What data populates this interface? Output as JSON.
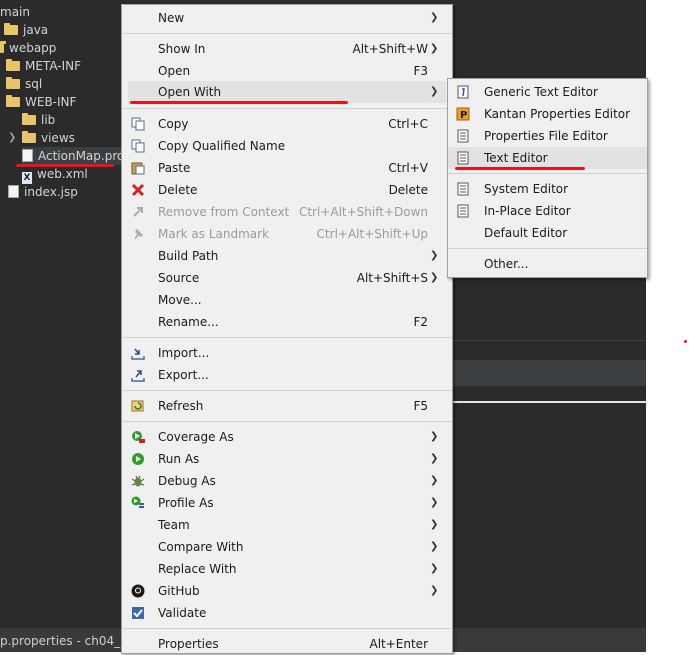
{
  "tree": {
    "items": [
      {
        "label": "main"
      },
      {
        "label": "java"
      },
      {
        "label": "webapp"
      },
      {
        "label": "META-INF"
      },
      {
        "label": "sql"
      },
      {
        "label": "WEB-INF"
      },
      {
        "label": "lib"
      },
      {
        "label": "views"
      },
      {
        "label": "ActionMap.pro"
      },
      {
        "label": "web.xml"
      },
      {
        "label": "index.jsp"
      }
    ]
  },
  "statusbar": {
    "text": "p.properties -   ch04_m"
  },
  "context_menu": {
    "new": "New",
    "show_in": "Show In",
    "show_in_accel": "Alt+Shift+W",
    "open": "Open",
    "open_accel": "F3",
    "open_with": "Open With",
    "copy": "Copy",
    "copy_accel": "Ctrl+C",
    "copy_qualified": "Copy Qualified Name",
    "paste": "Paste",
    "paste_accel": "Ctrl+V",
    "delete": "Delete",
    "delete_accel": "Delete",
    "remove_context": "Remove from Context",
    "remove_context_accel": "Ctrl+Alt+Shift+Down",
    "mark_landmark": "Mark as Landmark",
    "mark_landmark_accel": "Ctrl+Alt+Shift+Up",
    "build_path": "Build Path",
    "source": "Source",
    "source_accel": "Alt+Shift+S",
    "move": "Move...",
    "rename": "Rename...",
    "rename_accel": "F2",
    "import": "Import...",
    "export": "Export...",
    "refresh": "Refresh",
    "refresh_accel": "F5",
    "coverage_as": "Coverage As",
    "run_as": "Run As",
    "debug_as": "Debug As",
    "profile_as": "Profile As",
    "team": "Team",
    "compare_with": "Compare With",
    "replace_with": "Replace With",
    "github": "GitHub",
    "validate": "Validate",
    "properties": "Properties",
    "properties_accel": "Alt+Enter"
  },
  "submenu": {
    "generic_text_editor": "Generic Text Editor",
    "kantan_properties_editor": "Kantan Properties Editor",
    "properties_file_editor": "Properties File Editor",
    "text_editor": "Text Editor",
    "system_editor": "System Editor",
    "in_place_editor": "In-Place Editor",
    "default_editor": "Default Editor",
    "other": "Other..."
  },
  "colors": {
    "annotation": "#e8141c",
    "menu_bg": "#f0f0f0",
    "panel_bg": "#2b2b2b"
  }
}
